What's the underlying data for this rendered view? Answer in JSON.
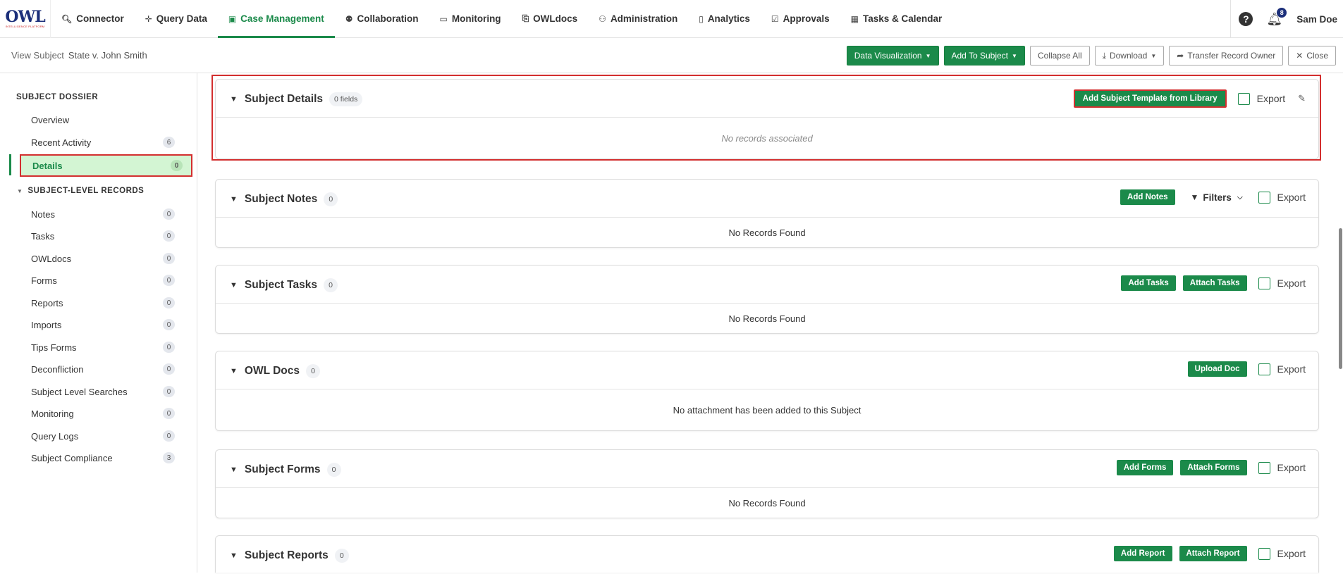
{
  "logo": {
    "word": "OWL",
    "sub": "INTELLIGENCE PLATFORM"
  },
  "nav": {
    "items": [
      {
        "label": "Connector",
        "icon": "search-icon"
      },
      {
        "label": "Query Data",
        "icon": "move-icon"
      },
      {
        "label": "Case Management",
        "icon": "case-icon"
      },
      {
        "label": "Collaboration",
        "icon": "people-icon"
      },
      {
        "label": "Monitoring",
        "icon": "monitor-icon"
      },
      {
        "label": "OWLdocs",
        "icon": "document-icon"
      },
      {
        "label": "Administration",
        "icon": "admin-icon"
      },
      {
        "label": "Analytics",
        "icon": "analytics-icon"
      },
      {
        "label": "Approvals",
        "icon": "approvals-icon"
      },
      {
        "label": "Tasks & Calendar",
        "icon": "calendar-icon"
      }
    ],
    "help": "?",
    "notification_count": "8",
    "user": "Sam Doe"
  },
  "subheader": {
    "prefix": "View Subject",
    "subject": "State v. John Smith",
    "data_visualization": "Data Visualization",
    "add_to_subject": "Add To Subject",
    "collapse_all": "Collapse All",
    "download": "Download",
    "transfer": "Transfer Record Owner",
    "close": "Close"
  },
  "sidebar": {
    "header": "SUBJECT DOSSIER",
    "top_items": [
      {
        "label": "Overview",
        "count": ""
      },
      {
        "label": "Recent Activity",
        "count": "6"
      },
      {
        "label": "Details",
        "count": "0"
      }
    ],
    "group": "SUBJECT-LEVEL RECORDS",
    "items": [
      {
        "label": "Notes",
        "count": "0"
      },
      {
        "label": "Tasks",
        "count": "0"
      },
      {
        "label": "OWLdocs",
        "count": "0"
      },
      {
        "label": "Forms",
        "count": "0"
      },
      {
        "label": "Reports",
        "count": "0"
      },
      {
        "label": "Imports",
        "count": "0"
      },
      {
        "label": "Tips Forms",
        "count": "0"
      },
      {
        "label": "Deconfliction",
        "count": "0"
      },
      {
        "label": "Subject Level Searches",
        "count": "0"
      },
      {
        "label": "Monitoring",
        "count": "0"
      },
      {
        "label": "Query Logs",
        "count": "0"
      },
      {
        "label": "Subject Compliance",
        "count": "3"
      }
    ]
  },
  "panels": {
    "details": {
      "title": "Subject Details",
      "pill": "0 fields",
      "add": "Add Subject Template from Library",
      "export": "Export",
      "empty": "No records associated"
    },
    "notes": {
      "title": "Subject Notes",
      "pill": "0",
      "add": "Add Notes",
      "filters": "Filters",
      "export": "Export",
      "empty": "No Records Found"
    },
    "tasks": {
      "title": "Subject Tasks",
      "pill": "0",
      "add": "Add Tasks",
      "attach": "Attach Tasks",
      "export": "Export",
      "empty": "No Records Found"
    },
    "docs": {
      "title": "OWL Docs",
      "pill": "0",
      "add": "Upload Doc",
      "export": "Export",
      "empty": "No attachment has been added to this Subject"
    },
    "forms": {
      "title": "Subject Forms",
      "pill": "0",
      "add": "Add Forms",
      "attach": "Attach Forms",
      "export": "Export",
      "empty": "No Records Found"
    },
    "reports": {
      "title": "Subject Reports",
      "pill": "0",
      "add": "Add Report",
      "attach": "Attach Report",
      "export": "Export"
    }
  }
}
